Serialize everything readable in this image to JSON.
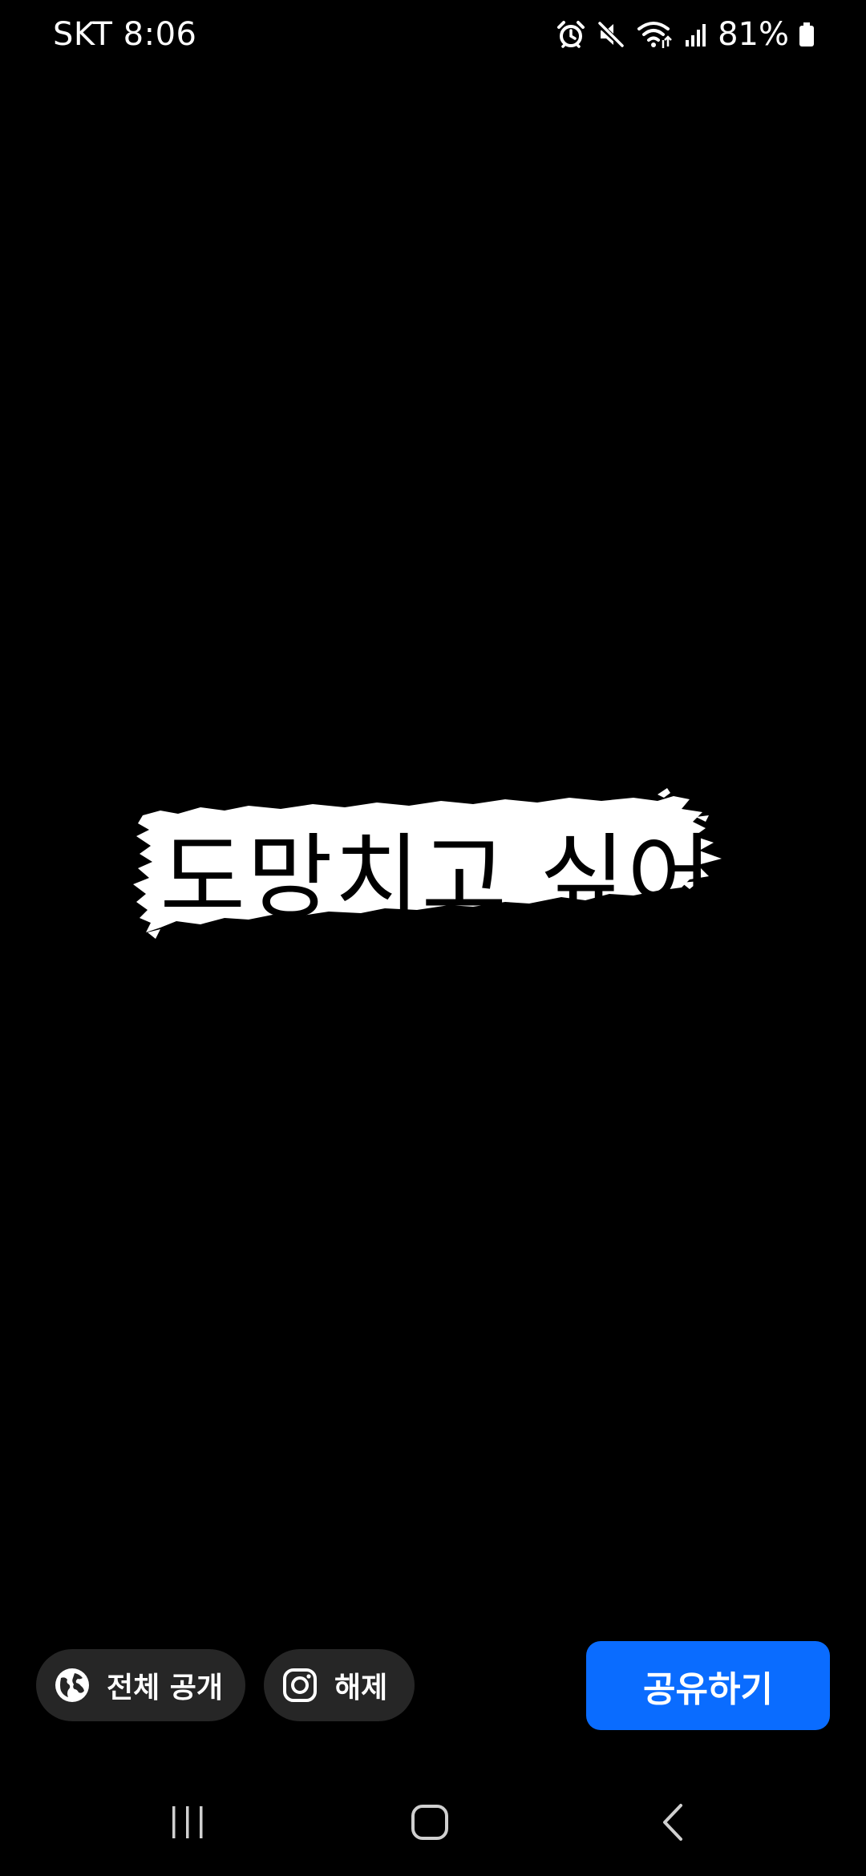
{
  "status_bar": {
    "carrier_time": "SKT 8:06",
    "battery": "81%",
    "icons": [
      "alarm-icon",
      "mute-icon",
      "wifi-icon",
      "signal-icon",
      "battery-icon"
    ]
  },
  "content": {
    "sticker_text": "도망치고 싶어",
    "background_color": "#000000",
    "sticker_color": "#ffffff"
  },
  "actions": {
    "visibility_label": "전체 공개",
    "visibility_icon": "globe-icon",
    "instagram_label": "해제",
    "instagram_icon": "instagram-icon",
    "share_label": "공유하기",
    "share_color": "#0a6cff"
  },
  "nav": {
    "icons": [
      "recents-icon",
      "home-icon",
      "back-icon"
    ]
  }
}
